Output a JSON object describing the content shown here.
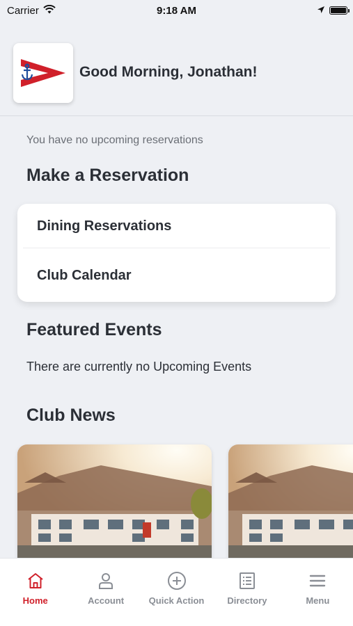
{
  "status_bar": {
    "carrier": "Carrier",
    "time": "9:18 AM"
  },
  "header": {
    "greeting": "Good Morning, Jonathan!"
  },
  "reservations": {
    "empty_message": "You have no upcoming reservations"
  },
  "make_reservation": {
    "title": "Make a Reservation",
    "items": [
      {
        "label": "Dining Reservations"
      },
      {
        "label": "Club Calendar"
      }
    ]
  },
  "featured_events": {
    "title": "Featured Events",
    "empty_message": "There are currently no Upcoming Events"
  },
  "club_news": {
    "title": "Club News"
  },
  "tabs": [
    {
      "label": "Home",
      "icon": "home-icon",
      "active": true
    },
    {
      "label": "Account",
      "icon": "account-icon",
      "active": false
    },
    {
      "label": "Quick Action",
      "icon": "plus-circle-icon",
      "active": false
    },
    {
      "label": "Directory",
      "icon": "directory-icon",
      "active": false
    },
    {
      "label": "Menu",
      "icon": "hamburger-menu-icon",
      "active": false
    }
  ],
  "colors": {
    "accent": "#d0202a",
    "background": "#eef0f4",
    "logo_blue": "#1f4e9c"
  }
}
